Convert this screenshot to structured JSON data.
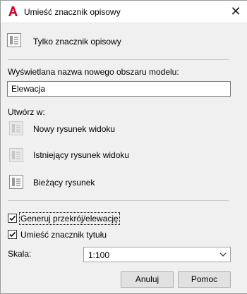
{
  "window": {
    "title": "Umieść znacznik opisowy",
    "app_icon": "autocad-a-icon",
    "close_symbol": "✕"
  },
  "callout_only": {
    "label": "Tylko znacznik opisowy",
    "icon": "callout-icon"
  },
  "model_space": {
    "label": "Wyświetlana nazwa nowego obszaru modelu:",
    "value": "Elewacja"
  },
  "create_in": {
    "label": "Utwórz w:",
    "options": [
      {
        "label": "Nowy rysunek widoku",
        "enabled": false,
        "icon": "new-drawing-icon"
      },
      {
        "label": "Istniejący rysunek widoku",
        "enabled": false,
        "icon": "existing-drawing-icon"
      },
      {
        "label": "Bieżący rysunek",
        "enabled": true,
        "icon": "current-drawing-icon"
      }
    ]
  },
  "generate_section": {
    "label": "Generuj przekrój/elewację",
    "checked": true
  },
  "place_title": {
    "label": "Umieść znacznik tytułu",
    "checked": true
  },
  "scale": {
    "label": "Skala:",
    "value": "1:100"
  },
  "buttons": {
    "cancel": "Anuluj",
    "help": "Pomoc"
  },
  "colors": {
    "accent_red": "#c8102e",
    "disabled_text": "#000000"
  }
}
